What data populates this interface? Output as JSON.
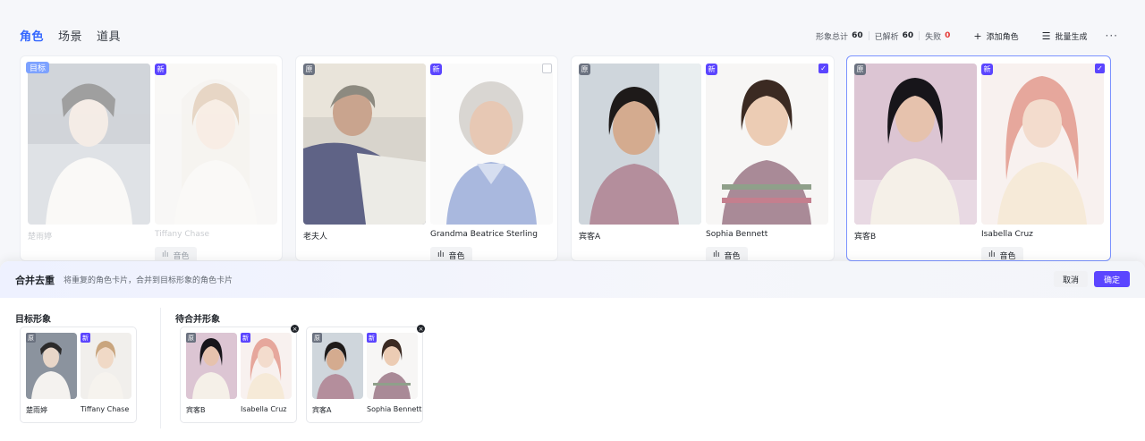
{
  "tabs": [
    {
      "label": "角色",
      "active": true
    },
    {
      "label": "场景",
      "active": false
    },
    {
      "label": "道具",
      "active": false
    }
  ],
  "stats": {
    "total_label": "形象总计",
    "total_value": "60",
    "parsed_label": "已解析",
    "parsed_value": "60",
    "failed_label": "失败",
    "failed_value": "0"
  },
  "header_buttons": {
    "add_role": "添加角色",
    "batch_generate": "批量生成",
    "more": "···"
  },
  "badges": {
    "original": "原",
    "new": "新",
    "target": "目标"
  },
  "cards": [
    {
      "left_name": "楚雨婷",
      "right_name": "Tiffany Chase",
      "voice": "音色",
      "target": true,
      "checked": false
    },
    {
      "left_name": "老夫人",
      "right_name": "Grandma Beatrice Sterling",
      "voice": "音色",
      "target": false,
      "checked": false
    },
    {
      "left_name": "宾客A",
      "right_name": "Sophia Bennett",
      "voice": "音色",
      "target": false,
      "checked": true
    },
    {
      "left_name": "宾客B",
      "right_name": "Isabella Cruz",
      "voice": "音色",
      "target": false,
      "checked": true
    }
  ],
  "sheet": {
    "title": "合并去重",
    "description": "将重复的角色卡片，合并到目标形象的角色卡片",
    "cancel": "取消",
    "confirm": "确定",
    "target_label": "目标形象",
    "pending_label": "待合并形象",
    "target_card": {
      "left_name": "楚雨婷",
      "right_name": "Tiffany Chase"
    },
    "pending_cards": [
      {
        "left_name": "宾客B",
        "right_name": "Isabella Cruz"
      },
      {
        "left_name": "宾客A",
        "right_name": "Sophia Bennett"
      }
    ]
  },
  "colors": {
    "accent": "#3366ff",
    "primary_button": "#5b45ff",
    "failed": "#e53935"
  }
}
